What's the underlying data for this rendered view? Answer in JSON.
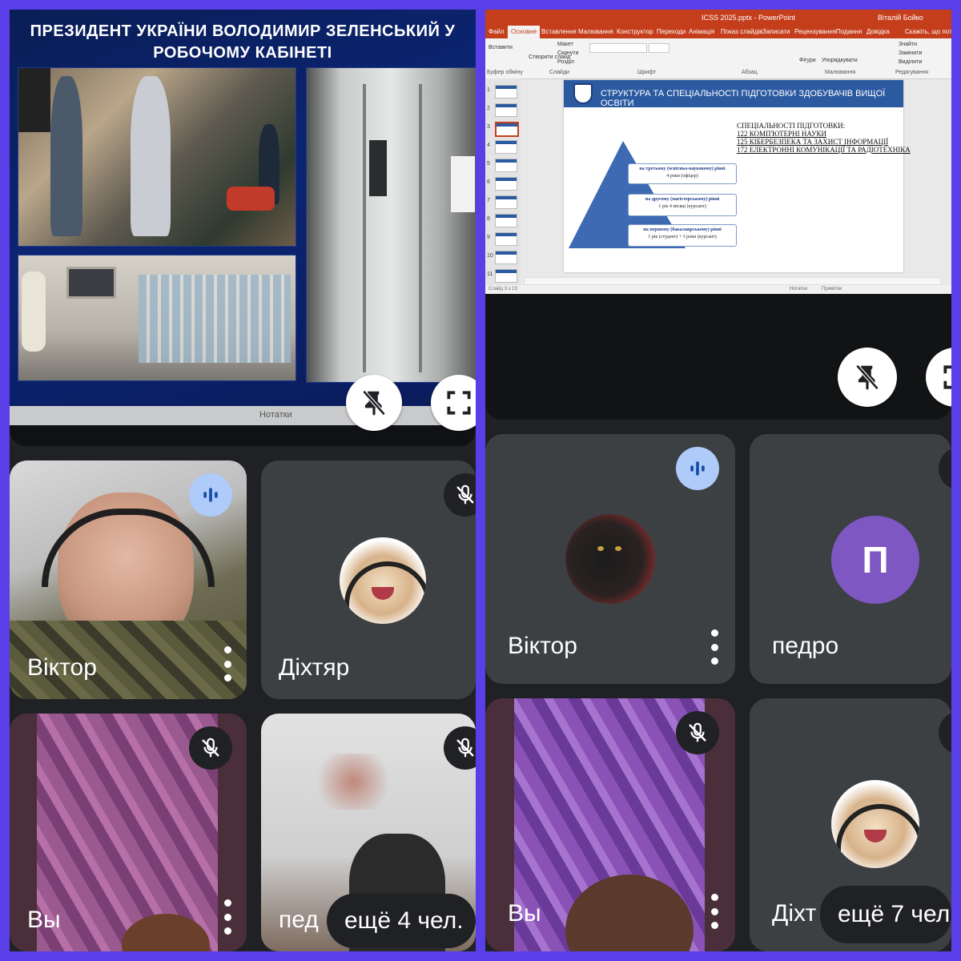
{
  "left": {
    "slide": {
      "title_line1": "ПРЕЗИДЕНТ УКРАЇНИ ВОЛОДИМИР ЗЕЛЕНСЬКИЙ У",
      "title_line2": "РОБОЧОМУ КАБІНЕТІ",
      "taskbar_label": "Нотатки"
    },
    "tiles": [
      {
        "name": "Віктор",
        "status": "speaking"
      },
      {
        "name": "Діхтяр",
        "status": "muted"
      },
      {
        "name": "Вы",
        "status": "muted"
      },
      {
        "name": "пед",
        "status": "muted"
      }
    ],
    "more_label": "ещё 4 чел."
  },
  "right": {
    "ppt": {
      "window_title": "ICSS 2025.pptx  -  PowerPoint",
      "user": "Віталій Бойко",
      "tabs": [
        "Файл",
        "Основне",
        "Вставлення",
        "Малювання",
        "Конструктор",
        "Переходи",
        "Анімація",
        "Показ слайдів",
        "Записати",
        "Рецензування",
        "Подання",
        "Довідка",
        "Скажіть, що потрібно зробити"
      ],
      "ribbon_groups": [
        "Буфер обміну",
        "Слайди",
        "Шрифт",
        "Абзац",
        "Малювання",
        "Редагування"
      ],
      "ribbon_items": [
        "Вставити",
        "Створити слайд",
        "Макет",
        "Скинути",
        "Розділ",
        "Фігури",
        "Упорядкувати",
        "Знайти",
        "Замінити",
        "Виділити"
      ],
      "slide_numbers": [
        "1",
        "2",
        "3",
        "4",
        "5",
        "6",
        "7",
        "8",
        "9",
        "10",
        "11"
      ],
      "slide_title": "СТРУКТУРА ТА СПЕЦІАЛЬНОСТІ ПІДГОТОВКИ ЗДОБУВАЧІВ ВИЩОЇ ОСВІТИ",
      "specialties_heading": "СПЕЦІАЛЬНОСТІ ПІДГОТОВКИ:",
      "specialties": [
        "122 КОМП'ЮТЕРНІ НАУКИ",
        "125 КІБЕРБЕЗПЕКА ТА ЗАХИСТ ІНФОРМАЦІЇ",
        "172 ЕЛЕКТРОННІ КОМУНІКАЦІЇ ТА РАДІОТЕХНІКА"
      ],
      "levels": [
        {
          "title": "на третьому (освітньо-науковому) рівні",
          "detail": "4 роки (офіцер)"
        },
        {
          "title": "на другому (магістерському) рівні",
          "detail": "1 рік 4 місяці (курсант)"
        },
        {
          "title": "на першому (бакалаврському) рівні",
          "detail": "1 рік (студент) + 3 роки (курсант)"
        }
      ],
      "status_left": "Слайд 3 з 13",
      "status_notes": "Нотатки",
      "status_comments": "Примітки"
    },
    "tiles": [
      {
        "name": "Віктор",
        "status": "speaking"
      },
      {
        "name": "педро",
        "status": "muted",
        "initial": "П"
      },
      {
        "name": "Вы",
        "status": "muted"
      },
      {
        "name": "Діхт",
        "status": "muted"
      }
    ],
    "more_label": "ещё 7 чел."
  },
  "colors": {
    "frame": "#5a3ee8",
    "meet_bg": "#202124",
    "tile_bg": "#3c4043",
    "speaking_badge": "#aecbfa",
    "avatar_purple": "#7e57c2",
    "ppt_accent": "#c43e1c",
    "slide_header": "#2b5aa1"
  },
  "icons": [
    "unpin-icon",
    "fullscreen-icon",
    "speaking-icon",
    "mic-off-icon",
    "more-vert-icon"
  ]
}
